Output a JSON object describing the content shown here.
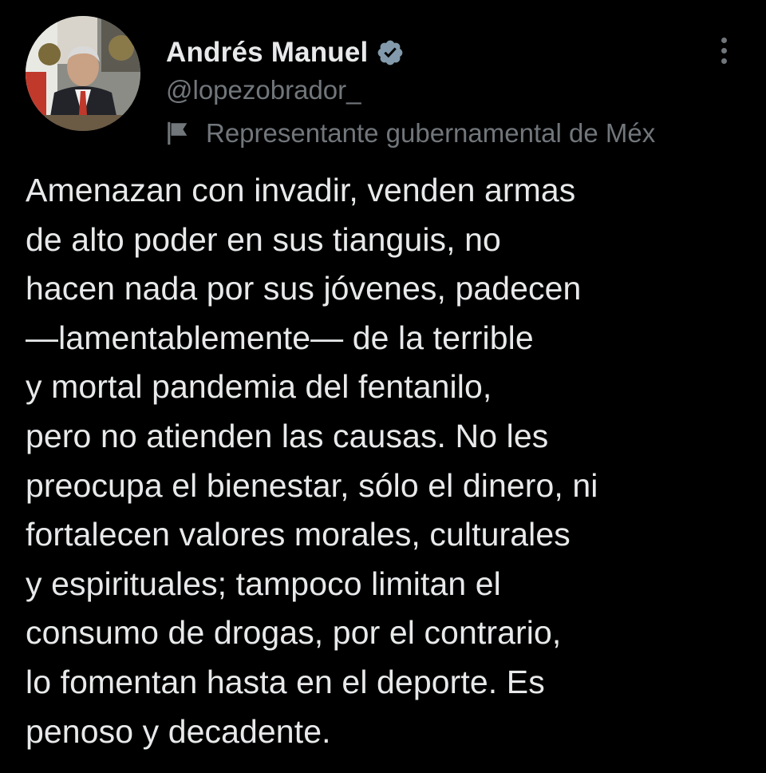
{
  "author": {
    "display_name": "Andrés Manuel",
    "handle": "@lopezobrador_",
    "affiliation_label": "Representante gubernamental de Méx",
    "verified": true,
    "avatar_icon": "profile-photo",
    "verified_icon": "verified-badge-icon",
    "affiliation_icon": "flag-icon",
    "more_icon": "more-options-icon"
  },
  "tweet": {
    "lines": [
      "Amenazan con invadir, venden armas",
      "de alto poder en sus tianguis, no",
      "hacen nada por sus jóvenes, padecen",
      "—lamentablemente— de la terrible",
      "y mortal pandemia del fentanilo,",
      "pero no atienden las causas. No les",
      "preocupa el bienestar, sólo el dinero, ni",
      "fortalecen valores morales, culturales",
      "y espirituales; tampoco limitan el",
      "consumo de drogas, por el contrario,",
      "lo fomentan hasta en el deporte. Es",
      "penoso y decadente."
    ]
  },
  "colors": {
    "background": "#000000",
    "primary_text": "#e7e9ea",
    "secondary_text": "#71767b",
    "verified_badge": "#829aab"
  }
}
